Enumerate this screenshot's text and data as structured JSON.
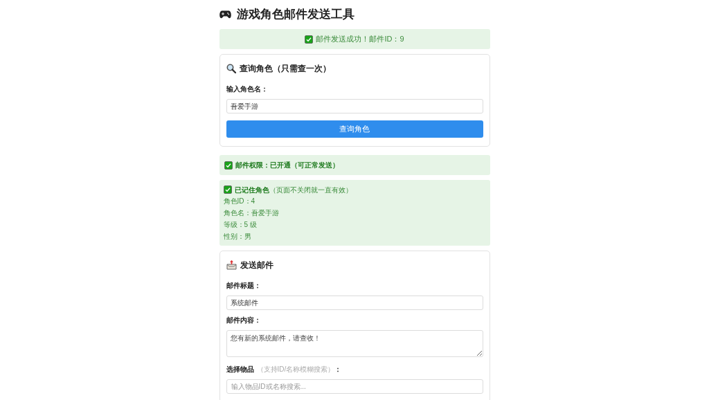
{
  "title": "游戏角色邮件发送工具",
  "success_banner": {
    "text": "邮件发送成功！邮件ID：9"
  },
  "query_card": {
    "heading": "查询角色（只需查一次）",
    "field_label": "输入角色名：",
    "field_value": "吾爱手游",
    "button": "查询角色"
  },
  "permission_banner": {
    "text": "邮件权限：已开通（可正常发送）"
  },
  "remembered_card": {
    "heading": "已记住角色",
    "note": "（页面不关闭就一直有效）",
    "lines": [
      "角色ID：4",
      "角色名：吾爱手游",
      "等级：5 级",
      "性别：男"
    ]
  },
  "send_card": {
    "heading": "发送邮件",
    "fields": [
      {
        "kind": "input",
        "label": "邮件标题：",
        "value": "系统邮件"
      },
      {
        "kind": "textarea",
        "label": "邮件内容：",
        "value": "您有新的系统邮件，请查收！"
      },
      {
        "kind": "search",
        "label": "选择物品",
        "hint": "（支持ID/名称模糊搜索）",
        "label_suffix": "：",
        "placeholder": "输入物品ID或名称搜索..."
      }
    ]
  }
}
